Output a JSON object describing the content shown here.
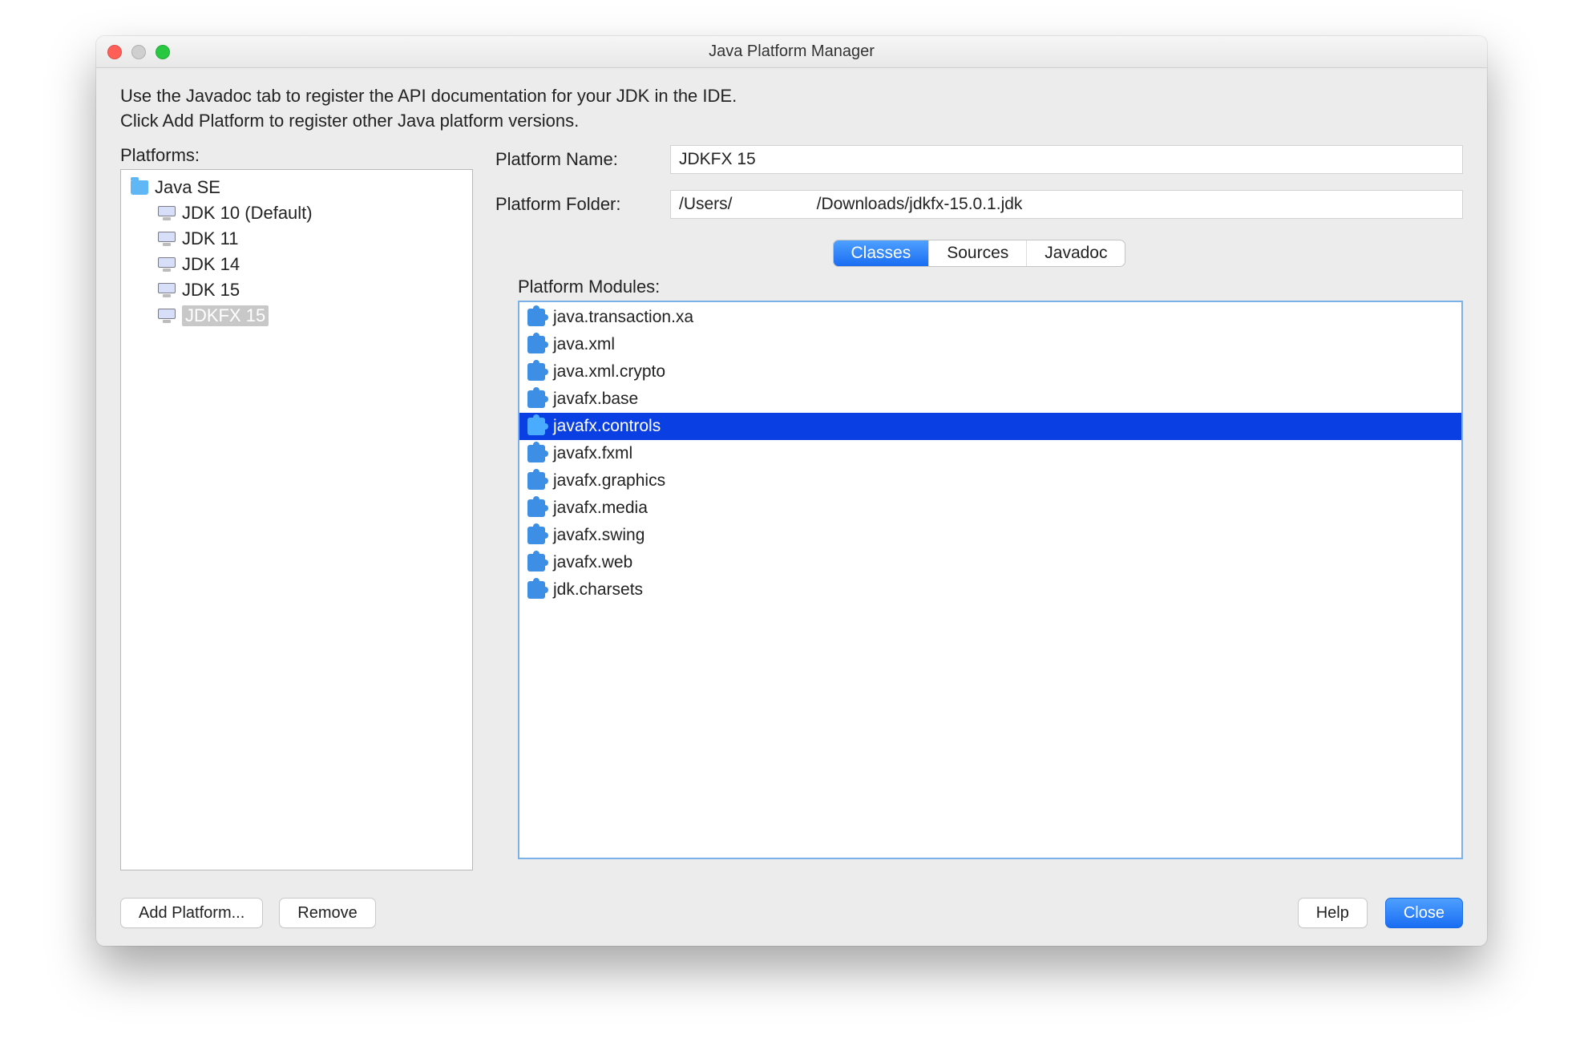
{
  "window": {
    "title": "Java Platform Manager"
  },
  "instructions": {
    "line1": "Use the Javadoc tab to register the API documentation for your JDK in the IDE.",
    "line2": "Click Add Platform to register other Java platform versions."
  },
  "left": {
    "label": "Platforms:",
    "group": "Java SE",
    "items": [
      {
        "label": "JDK 10 (Default)",
        "selected": false
      },
      {
        "label": "JDK 11",
        "selected": false
      },
      {
        "label": "JDK 14",
        "selected": false
      },
      {
        "label": "JDK 15",
        "selected": false
      },
      {
        "label": "JDKFX 15",
        "selected": true
      }
    ],
    "add_button": "Add Platform...",
    "remove_button": "Remove"
  },
  "right": {
    "name_label": "Platform Name:",
    "name_value": "JDKFX 15",
    "folder_label": "Platform Folder:",
    "folder_value": "/Users/         /Downloads/jdkfx-15.0.1.jdk",
    "tabs": [
      {
        "label": "Classes",
        "active": true
      },
      {
        "label": "Sources",
        "active": false
      },
      {
        "label": "Javadoc",
        "active": false
      }
    ],
    "modules_label": "Platform Modules:",
    "modules": [
      {
        "label": "java.transaction.xa",
        "selected": false
      },
      {
        "label": "java.xml",
        "selected": false
      },
      {
        "label": "java.xml.crypto",
        "selected": false
      },
      {
        "label": "javafx.base",
        "selected": false
      },
      {
        "label": "javafx.controls",
        "selected": true
      },
      {
        "label": "javafx.fxml",
        "selected": false
      },
      {
        "label": "javafx.graphics",
        "selected": false
      },
      {
        "label": "javafx.media",
        "selected": false
      },
      {
        "label": "javafx.swing",
        "selected": false
      },
      {
        "label": "javafx.web",
        "selected": false
      },
      {
        "label": "jdk.charsets",
        "selected": false
      }
    ]
  },
  "footer": {
    "help": "Help",
    "close": "Close"
  }
}
